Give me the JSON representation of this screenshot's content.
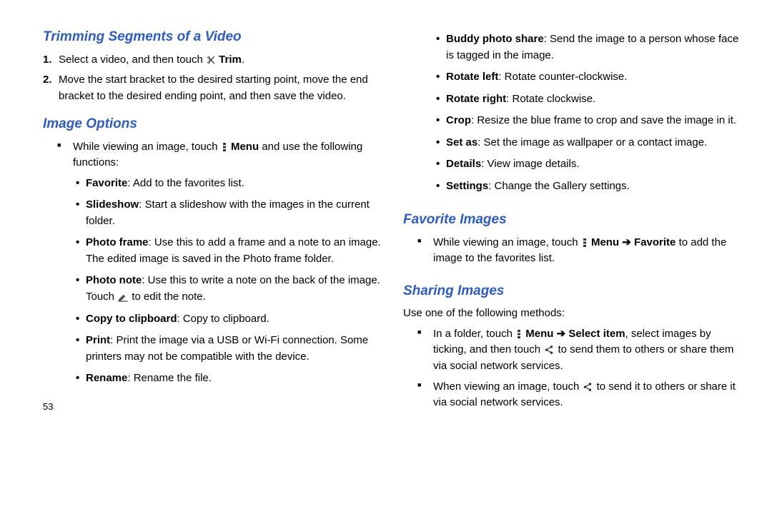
{
  "page_number": "53",
  "left": {
    "h1": "Trimming Segments of a Video",
    "steps": [
      {
        "num": "1.",
        "pre": "Select a video, and then touch ",
        "icon": "scissors",
        "post_b": "Trim",
        "post": "."
      },
      {
        "num": "2.",
        "text": "Move the start bracket to the desired starting point, move the end bracket to the desired ending point, and then save the video."
      }
    ],
    "h2": "Image Options",
    "intro_pre": "While viewing an image, touch ",
    "intro_icon": "menu",
    "intro_b": "Menu",
    "intro_post": " and use the following functions:",
    "bullets": [
      {
        "b": "Favorite",
        "t": ": Add to the favorites list."
      },
      {
        "b": "Slideshow",
        "t": ": Start a slideshow with the images in the current folder."
      },
      {
        "b": "Photo frame",
        "t": ": Use this to add a frame and a note to an image. The edited image is saved in the Photo frame folder."
      },
      {
        "b": "Photo note",
        "t_pre": ": Use this to write a note on the back of the image. Touch ",
        "icon": "edit",
        "t_post": " to edit the note."
      },
      {
        "b": "Copy to clipboard",
        "t": ": Copy to clipboard."
      },
      {
        "b": "Print",
        "t": ": Print the image via a USB or Wi-Fi connection. Some printers may not be compatible with the device."
      },
      {
        "b": "Rename",
        "t": ": Rename the file."
      }
    ]
  },
  "right": {
    "top_bullets": [
      {
        "b": "Buddy photo share",
        "t": ": Send the image to a person whose face is tagged in the image."
      },
      {
        "b": "Rotate left",
        "t": ": Rotate counter-clockwise."
      },
      {
        "b": "Rotate right",
        "t": ": Rotate clockwise."
      },
      {
        "b": "Crop",
        "t": ": Resize the blue frame to crop and save the image in it."
      },
      {
        "b": "Set as",
        "t": ": Set the image as wallpaper or a contact image."
      },
      {
        "b": "Details",
        "t": ": View image details."
      },
      {
        "b": "Settings",
        "t": ": Change the Gallery settings."
      }
    ],
    "h_fav": "Favorite Images",
    "fav_pre": "While viewing an image, touch ",
    "fav_b1": "Menu",
    "fav_arrow": " ➔ ",
    "fav_b2": "Favorite",
    "fav_post": " to add the image to the favorites list.",
    "h_share": "Sharing Images",
    "share_lead": "Use one of the following methods:",
    "share1_pre": "In a folder, touch ",
    "share1_b1": "Menu",
    "share1_arrow": " ➔ ",
    "share1_b2": "Select item",
    "share1_mid": ", select images by ticking, and then touch ",
    "share1_post": " to send them to others or share them via social network services.",
    "share2_pre": "When viewing an image, touch ",
    "share2_post": " to send it to others or share it via social network services."
  }
}
